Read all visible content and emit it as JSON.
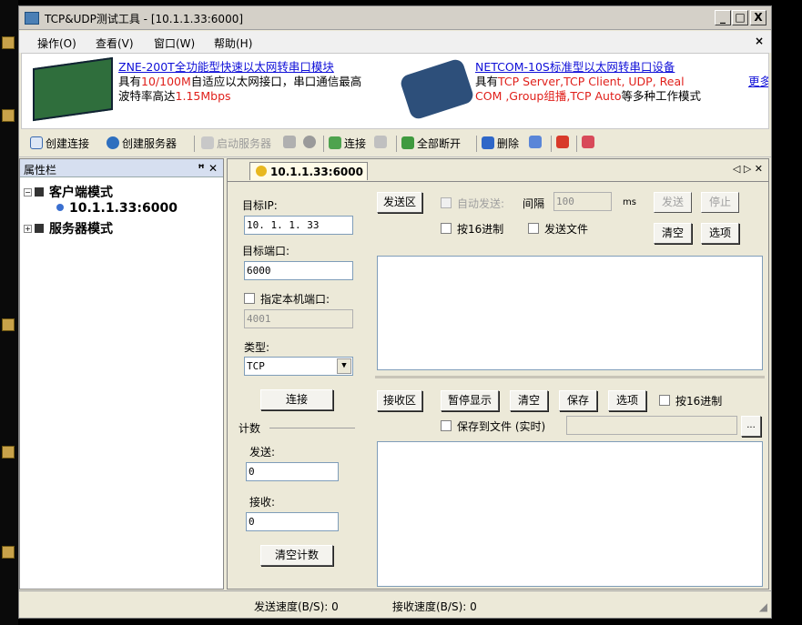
{
  "window": {
    "title": "TCP&UDP测试工具 - [10.1.1.33:6000]",
    "controls": [
      "_",
      "□",
      "X"
    ]
  },
  "menu": {
    "items": [
      "操作(O)",
      "查看(V)",
      "窗口(W)",
      "帮助(H)"
    ],
    "close": "×"
  },
  "banner": {
    "ad1": {
      "link": "ZNE-200T全功能型快速以太网转串口模块",
      "line2_a": "具有",
      "line2_red": "10/100M",
      "line2_b": "自适应以太网接口，串口通信最高",
      "line3_a": "波特率高达",
      "line3_red": "1.15Mbps"
    },
    "ad2": {
      "link": "NETCOM-10S标准型以太网转串口设备",
      "line2_a": "具有",
      "line2_red": "TCP Server,TCP Client, UDP, Real",
      "line3_red": "COM ,Group组播,TCP Auto",
      "line3_b": "等多种工作模式"
    },
    "more": "更多"
  },
  "toolbar": {
    "create_conn": "创建连接",
    "create_server": "创建服务器",
    "start_server": "启动服务器",
    "connect": "连接",
    "disconnect_all": "全部断开",
    "delete": "删除"
  },
  "property_panel": {
    "title": "属性栏",
    "pin": "ꟸ ✕",
    "tree": {
      "client_mode": "客户端模式",
      "connection": "10.1.1.33:6000",
      "server_mode": "服务器模式"
    }
  },
  "tab": {
    "label": "10.1.1.33:6000",
    "nav": "◁ ▷ ✕"
  },
  "settings": {
    "target_ip_label": "目标IP:",
    "target_ip": "10. 1. 1. 33",
    "target_port_label": "目标端口:",
    "target_port": "6000",
    "local_port_label": "指定本机端口:",
    "local_port": "4001",
    "type_label": "类型:",
    "type_value": "TCP",
    "connect_button": "连接",
    "count_label": "计数",
    "send_label": "发送:",
    "send_count": "0",
    "recv_label": "接收:",
    "recv_count": "0",
    "clear_count_button": "清空计数"
  },
  "send_area": {
    "title": "发送区",
    "auto_send": "自动发送:",
    "interval_label": "间隔",
    "interval_value": "100",
    "interval_unit": "ms",
    "send_button": "发送",
    "stop_button": "停止",
    "hex_label": "按16进制",
    "send_file_label": "发送文件",
    "clear_button": "清空",
    "options_button": "选项"
  },
  "recv_area": {
    "title": "接收区",
    "pause_button": "暂停显示",
    "clear_button": "清空",
    "save_button": "保存",
    "options_button": "选项",
    "hex_label": "按16进制",
    "save_to_file_label": "保存到文件 (实时)",
    "browse_button": "..."
  },
  "status": {
    "send_speed": "发送速度(B/S): 0",
    "recv_speed": "接收速度(B/S): 0"
  }
}
